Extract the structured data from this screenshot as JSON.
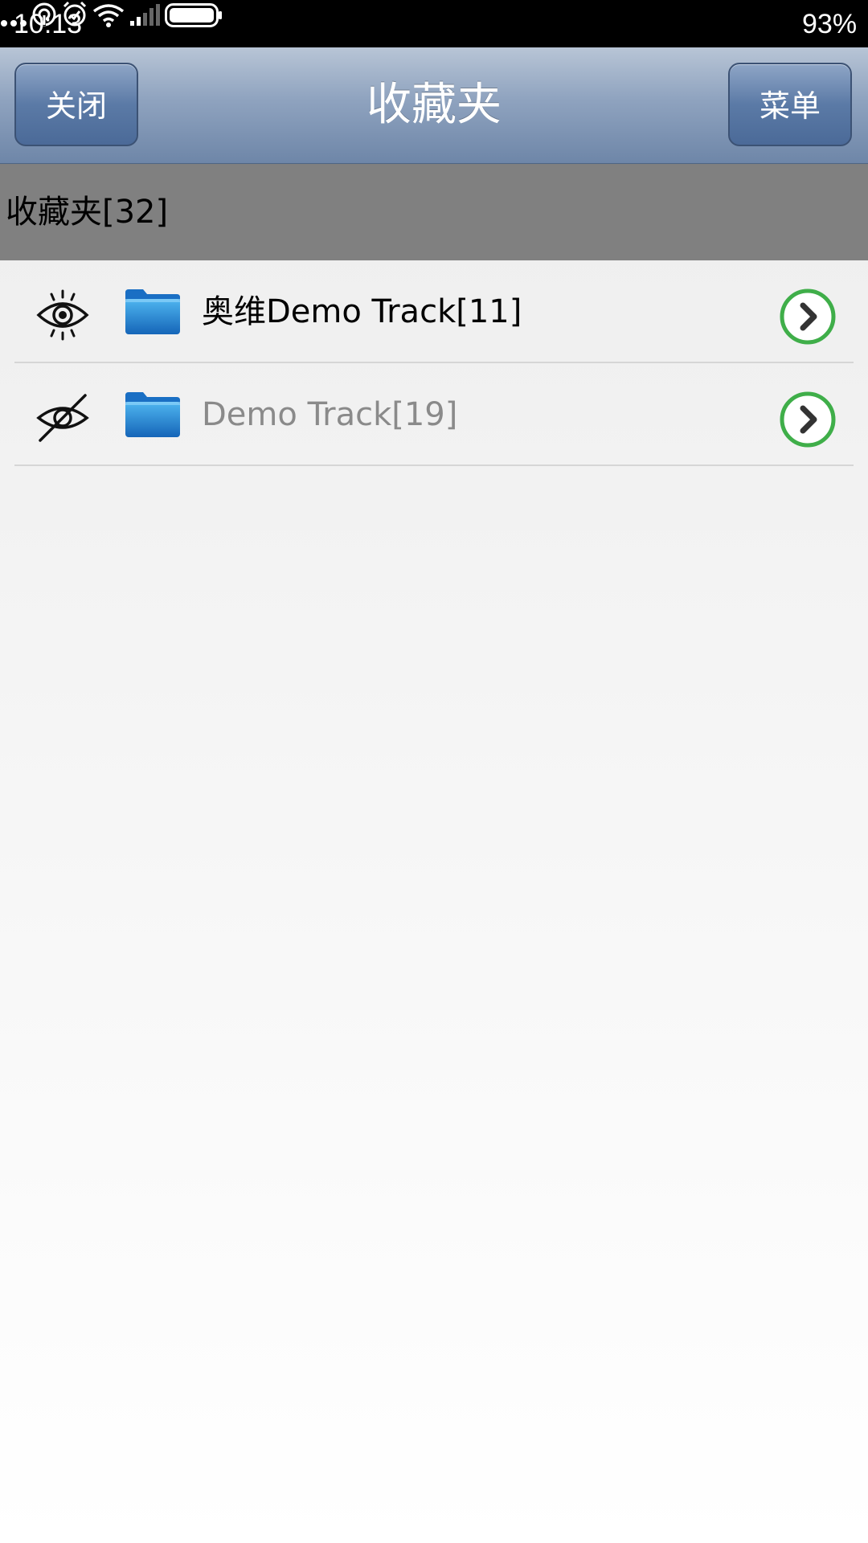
{
  "status_bar": {
    "time": "10:13",
    "battery_percent": "93%",
    "icons": [
      "more-dots-icon",
      "hotspot-icon",
      "alarm-icon",
      "wifi-icon",
      "signal-icon",
      "battery-icon"
    ]
  },
  "nav": {
    "close_label": "关闭",
    "title": "收藏夹",
    "menu_label": "菜单"
  },
  "section": {
    "title": "收藏夹[32]"
  },
  "folders": [
    {
      "label": "奥维Demo Track[11]",
      "visible": true,
      "icon": "eye-icon"
    },
    {
      "label": "Demo Track[19]",
      "visible": false,
      "icon": "eye-hidden-icon"
    }
  ],
  "colors": {
    "nav_gradient_top": "#b8c5d6",
    "nav_gradient_bottom": "#6e86a8",
    "section_header_bg": "#808080",
    "arrow_green": "#3fae49",
    "folder_blue": "#1e88d8",
    "hidden_text": "#8a8a8a"
  }
}
